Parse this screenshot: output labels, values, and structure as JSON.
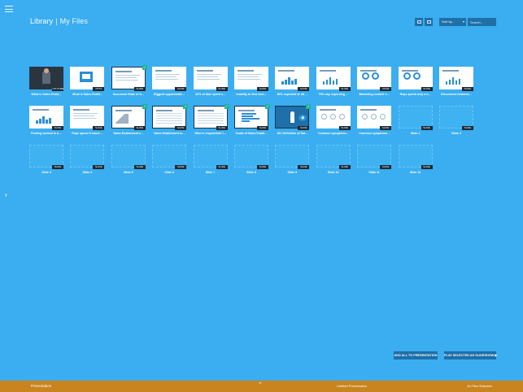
{
  "header": {
    "title": "Library",
    "separator": "|",
    "subtitle": "My Files",
    "sort_label": "Sort by...",
    "search_placeholder": "Search..."
  },
  "tiles": [
    {
      "label": "What is Sales Enabl...",
      "badge": "YOUTUBE",
      "art": "video",
      "selected": false
    },
    {
      "label": "What is Sales Enabl...",
      "badge": "PPTX",
      "art": "doc",
      "selected": false
    },
    {
      "label": "Document State of S...",
      "badge": "SLIDE",
      "art": "lines",
      "selected": true
    },
    {
      "label": "Biggest opportunitie...",
      "badge": "SLIDE",
      "art": "lines",
      "selected": false
    },
    {
      "label": "32% of time spent s...",
      "badge": "SLIDE",
      "art": "lines",
      "selected": false
    },
    {
      "label": "Inability to find cont...",
      "badge": "SLIDE",
      "art": "lines",
      "selected": false
    },
    {
      "label": "50% expected to hit ...",
      "badge": "SLIDE",
      "art": "bars",
      "selected": false
    },
    {
      "label": "79% say improving ...",
      "badge": "SLIDE",
      "art": "bars",
      "selected": false
    },
    {
      "label": "Marketing content n...",
      "badge": "SLIDE",
      "art": "donut",
      "selected": false
    },
    {
      "label": "Reps spend only a s...",
      "badge": "SLIDE",
      "art": "donut",
      "selected": false
    },
    {
      "label": "Disconnect between...",
      "badge": "SLIDE",
      "art": "bars",
      "selected": false
    },
    {
      "label": "Finding content is a ...",
      "badge": "SLIDE",
      "art": "bars",
      "selected": false
    },
    {
      "label": "Reps spend 8 hours ...",
      "badge": "SLIDE",
      "art": "lines",
      "selected": false
    },
    {
      "label": "Sales Enablement c...",
      "badge": "SLIDE",
      "art": "graph",
      "selected": true
    },
    {
      "label": "Sales Enablement in...",
      "badge": "SLIDE",
      "art": "table",
      "selected": true
    },
    {
      "label": "Who is responsible f...",
      "badge": "SLIDE",
      "art": "table",
      "selected": true
    },
    {
      "label": "Goals of Sales Enabl...",
      "badge": "SLIDE",
      "art": "hbars",
      "selected": true
    },
    {
      "label": "ISC Definition of Sal...",
      "badge": "SLIDE",
      "art": "rocket",
      "selected": true
    },
    {
      "label": "Common symptoms...",
      "badge": "SLIDE",
      "art": "icons",
      "selected": false
    },
    {
      "label": "Common symptoms...",
      "badge": "SLIDE",
      "art": "icons",
      "selected": false
    },
    {
      "label": "Slide 1",
      "badge": "SLIDE",
      "art": "blank",
      "selected": false
    },
    {
      "label": "Slide 2",
      "badge": "SLIDE",
      "art": "blank",
      "selected": false
    },
    {
      "label": "Slide 3",
      "badge": "SLIDE",
      "art": "blank",
      "selected": false
    },
    {
      "label": "Slide 4",
      "badge": "SLIDE",
      "art": "blank",
      "selected": false
    },
    {
      "label": "Slide 5",
      "badge": "SLIDE",
      "art": "blank",
      "selected": false
    },
    {
      "label": "Slide 6",
      "badge": "SLIDE",
      "art": "blank",
      "selected": false
    },
    {
      "label": "Slide 7",
      "badge": "SLIDE",
      "art": "blank",
      "selected": false
    },
    {
      "label": "Slide 8",
      "badge": "SLIDE",
      "art": "blank",
      "selected": false
    },
    {
      "label": "Slide 9",
      "badge": "SLIDE",
      "art": "blank",
      "selected": false
    },
    {
      "label": "Slide 10",
      "badge": "SLIDE",
      "art": "blank",
      "selected": false
    },
    {
      "label": "Slide 11",
      "badge": "SLIDE",
      "art": "blank",
      "selected": false
    },
    {
      "label": "Slide 12",
      "badge": "SLIDE",
      "art": "blank",
      "selected": false
    }
  ],
  "actions": {
    "add_all_label": "ADD ALL TO PRESENTATION",
    "play_selected_label": "PLAY SELECTED AS SLIDESHOW ▶"
  },
  "footer": {
    "left_label": "Presentation",
    "presentation_name": "Untitled Presentation",
    "files_selected": "14 Files Selected"
  },
  "colors": {
    "background": "#3aaef0",
    "footer": "#c9841f",
    "button": "#1f6fa8",
    "selected_check": "#1fb59a"
  }
}
